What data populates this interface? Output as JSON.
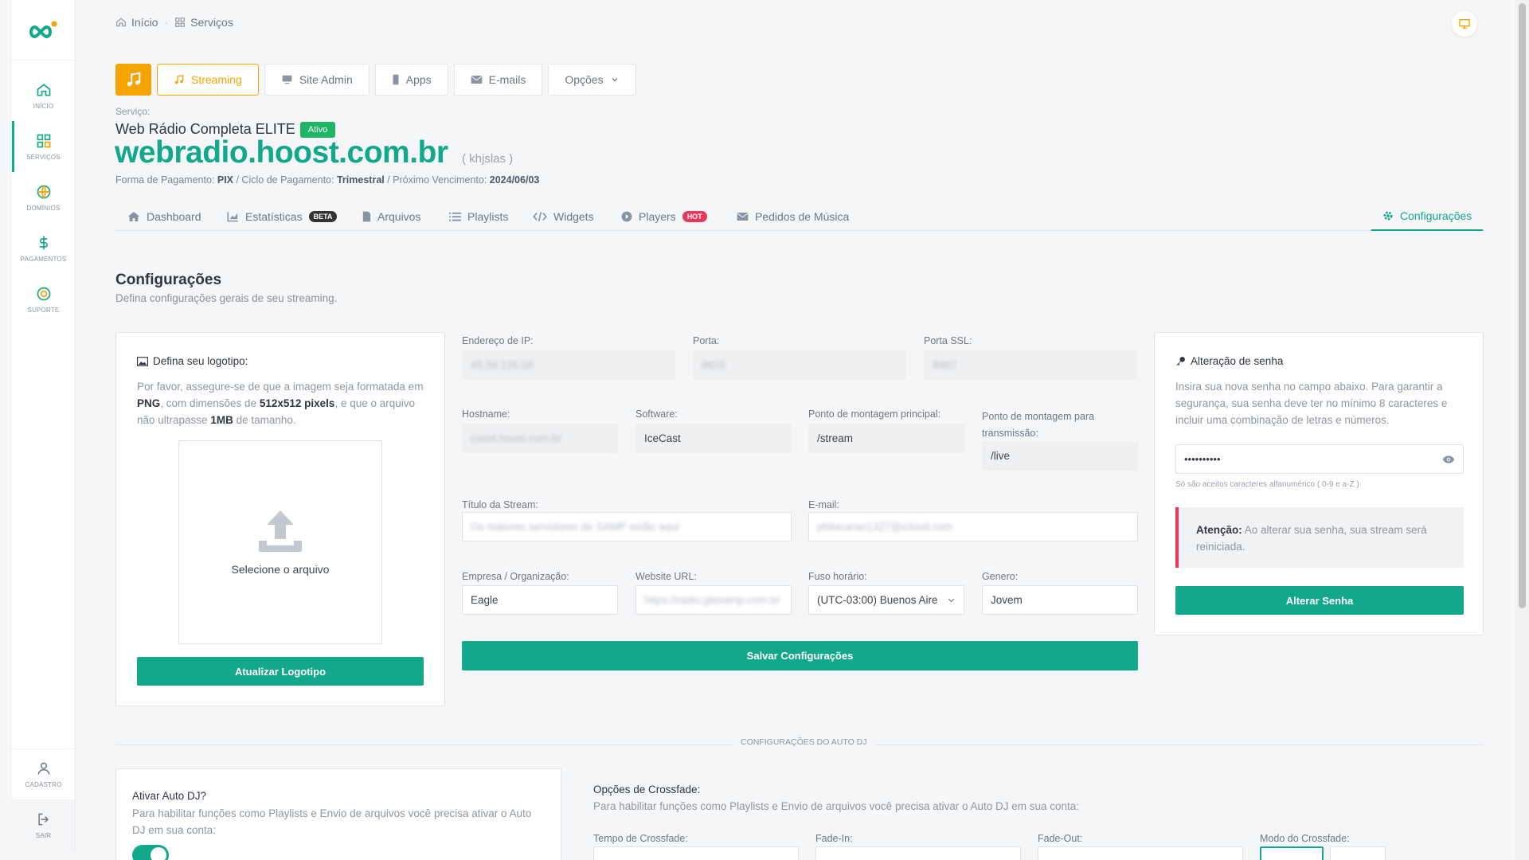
{
  "colors": {
    "accent": "#13a88a",
    "orange": "#f5a300",
    "danger": "#e8385b",
    "active_badge": "#1fb566"
  },
  "sidebar": {
    "items": [
      {
        "label": "Início",
        "icon": "home-icon"
      },
      {
        "label": "Serviços",
        "icon": "grid-icon"
      },
      {
        "label": "Domínios",
        "icon": "globe-icon"
      },
      {
        "label": "Pagamentos",
        "icon": "dollar-icon"
      },
      {
        "label": "Suporte",
        "icon": "lifebuoy-icon"
      }
    ],
    "bottom": [
      {
        "label": "Cadastro",
        "icon": "user-icon"
      },
      {
        "label": "Sair",
        "icon": "logout-icon"
      }
    ]
  },
  "breadcrumb": {
    "home": "Início",
    "current": "Serviços"
  },
  "service_tabs": {
    "streaming": "Streaming",
    "site_admin": "Site Admin",
    "apps": "Apps",
    "emails": "E-mails",
    "options": "Opções"
  },
  "service": {
    "label": "Serviço:",
    "name": "Web Rádio Completa ELITE",
    "status": "Ativo",
    "domain": "webradio.hoost.com.br",
    "username": "( khjslas )",
    "payment_method_label": "Forma de Pagamento:",
    "payment_method": "PIX",
    "cycle_label": "/ Ciclo de Pagamento:",
    "cycle": "Trimestral",
    "due_label": "/ Próximo Vencimento:",
    "due": "2024/06/03"
  },
  "section_tabs": {
    "dashboard": "Dashboard",
    "stats": "Estatísticas",
    "stats_badge": "BETA",
    "files": "Arquivos",
    "playlists": "Playlists",
    "widgets": "Widgets",
    "players": "Players",
    "players_badge": "HOT",
    "requests": "Pedidos de Música",
    "settings": "Configurações"
  },
  "page": {
    "title": "Configurações",
    "description": "Defina configurações gerais de seu streaming."
  },
  "logo_card": {
    "title": "Defina seu logotipo:",
    "text_1": "Por favor, assegure-se de que a imagem seja formatada em",
    "fmt": "PNG",
    "text_2": ", com dimensões de",
    "dims": "512x512 pixels",
    "text_3": ", e que o arquivo não ultrapasse",
    "size": "1MB",
    "text_4": "de tamanho.",
    "dropzone_label": "Selecione o arquivo",
    "button": "Atualizar Logotipo"
  },
  "form": {
    "ip_label": "Endereço de IP:",
    "ip_value": "45.58.126.58",
    "port_label": "Porta:",
    "port_value": "8616",
    "ssl_label": "Porta SSL:",
    "ssl_value": "8467",
    "hostname_label": "Hostname:",
    "hostname_value": "cast4.hoost.com.br",
    "software_label": "Software:",
    "software_value": "IceCast",
    "mount_label": "Ponto de montagem principal:",
    "mount_value": "/stream",
    "trans_label_1": "Ponto de montagem para",
    "trans_label_2": "transmissão:",
    "trans_value": "/live",
    "title_label": "Título da Stream:",
    "title_value": "Os maiores servidores de SAMP estão aqui",
    "email_label": "E-mail:",
    "email_value": "philacaran1327@icloud.com",
    "company_label": "Empresa / Organização:",
    "company_value": "Eagle",
    "website_label": "Website URL:",
    "website_value": "https://radio.glasamp.com.br",
    "tz_label": "Fuso horário:",
    "tz_value": "(UTC-03:00) Buenos Aire",
    "genre_label": "Genero:",
    "genre_value": "Jovem",
    "save_button": "Salvar Configurações"
  },
  "password_card": {
    "title": "Alteração de senha",
    "text": "Insira sua nova senha no campo abaixo. Para garantir a segurança, sua senha deve ter no mínimo 8 caracteres e incluir uma combinação de letras e números.",
    "password_mask": "••••••••••",
    "hint": "Só são aceitos caracteres alfanumérico ( 0-9 e a-Z )",
    "alert_strong": "Atenção:",
    "alert_text": "Ao alterar sua senha, sua stream será reiniciada.",
    "button": "Alterar Senha"
  },
  "autodj": {
    "divider": "Configurações do Auto DJ",
    "enable_title": "Ativar Auto DJ?",
    "enable_text": "Para habilitar funções como Playlists e Envio de arquivos você precisa ativar o Auto DJ em sua conta:",
    "enabled": true,
    "crossfade_title": "Opções de Crossfade:",
    "crossfade_text": "Para habilitar funções como Playlists e Envio de arquivos você precisa ativar o Auto DJ em sua conta:",
    "crossfade_time_label": "Tempo de Crossfade:",
    "fade_in_label": "Fade-In:",
    "fade_out_label": "Fade-Out:",
    "mode_label": "Modo do Crossfade:"
  }
}
